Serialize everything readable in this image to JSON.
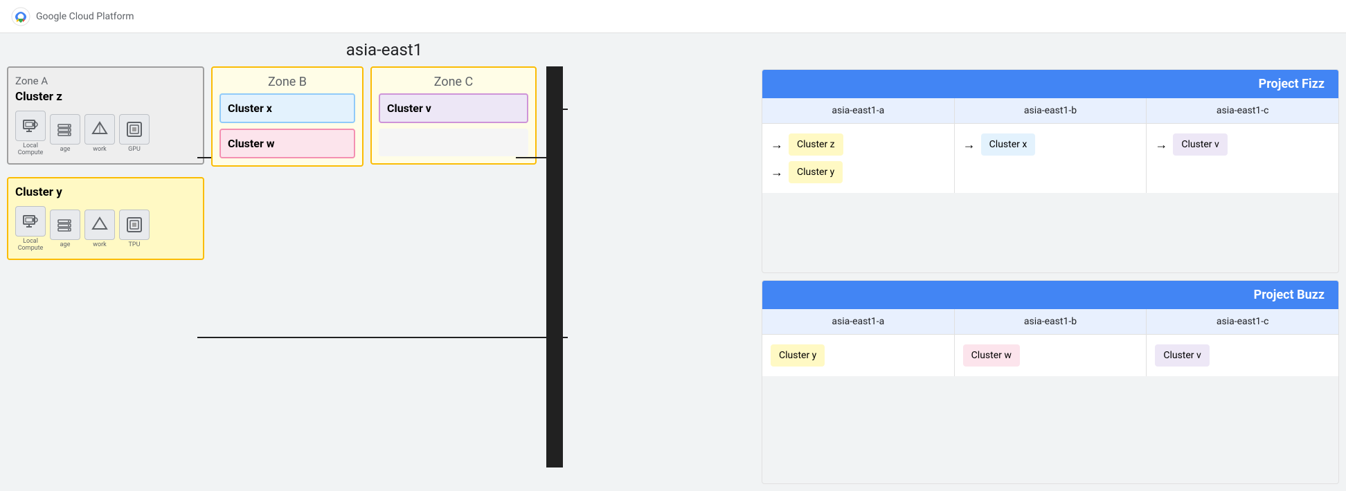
{
  "topbar": {
    "logo_text": "Google Cloud Platform"
  },
  "diagram": {
    "region_label": "asia-east1",
    "zone_a": {
      "label": "Zone A",
      "cluster_z": {
        "name": "Cluster z",
        "icons": [
          {
            "label": "Local\nCompute",
            "symbol": "🖥"
          },
          {
            "label": "age",
            "symbol": "≡"
          },
          {
            "label": "work",
            "symbol": "▶"
          },
          {
            "label": "GPU",
            "symbol": "⊞"
          }
        ]
      },
      "cluster_y": {
        "name": "Cluster y",
        "icons": [
          {
            "label": "Local\nCompute",
            "symbol": "🖥"
          },
          {
            "label": "age",
            "symbol": "≡"
          },
          {
            "label": "work",
            "symbol": "▶"
          },
          {
            "label": "TPU",
            "symbol": "⊞"
          }
        ]
      }
    },
    "zone_b": {
      "label": "Zone B",
      "cluster_x": {
        "name": "Cluster x"
      },
      "cluster_w": {
        "name": "Cluster w"
      }
    },
    "zone_c": {
      "label": "Zone C",
      "cluster_v": {
        "name": "Cluster v"
      }
    },
    "project_fizz": {
      "title": "Project Fizz",
      "cols": [
        {
          "header": "asia-east1-a",
          "clusters": [
            {
              "name": "Cluster z",
              "style": "yellow",
              "arrow": true
            },
            {
              "name": "Cluster y",
              "style": "yellow",
              "arrow": true
            }
          ]
        },
        {
          "header": "asia-east1-b",
          "clusters": [
            {
              "name": "Cluster x",
              "style": "blue-light",
              "arrow": true
            }
          ]
        },
        {
          "header": "asia-east1-c",
          "clusters": [
            {
              "name": "Cluster v",
              "style": "lavender",
              "arrow": false
            }
          ]
        }
      ]
    },
    "project_buzz": {
      "title": "Project Buzz",
      "cols": [
        {
          "header": "asia-east1-a",
          "clusters": [
            {
              "name": "Cluster y",
              "style": "yellow",
              "arrow": false
            }
          ]
        },
        {
          "header": "asia-east1-b",
          "clusters": [
            {
              "name": "Cluster w",
              "style": "pink",
              "arrow": false
            }
          ]
        },
        {
          "header": "asia-east1-c",
          "clusters": [
            {
              "name": "Cluster v",
              "style": "lavender",
              "arrow": false
            }
          ]
        }
      ]
    }
  }
}
